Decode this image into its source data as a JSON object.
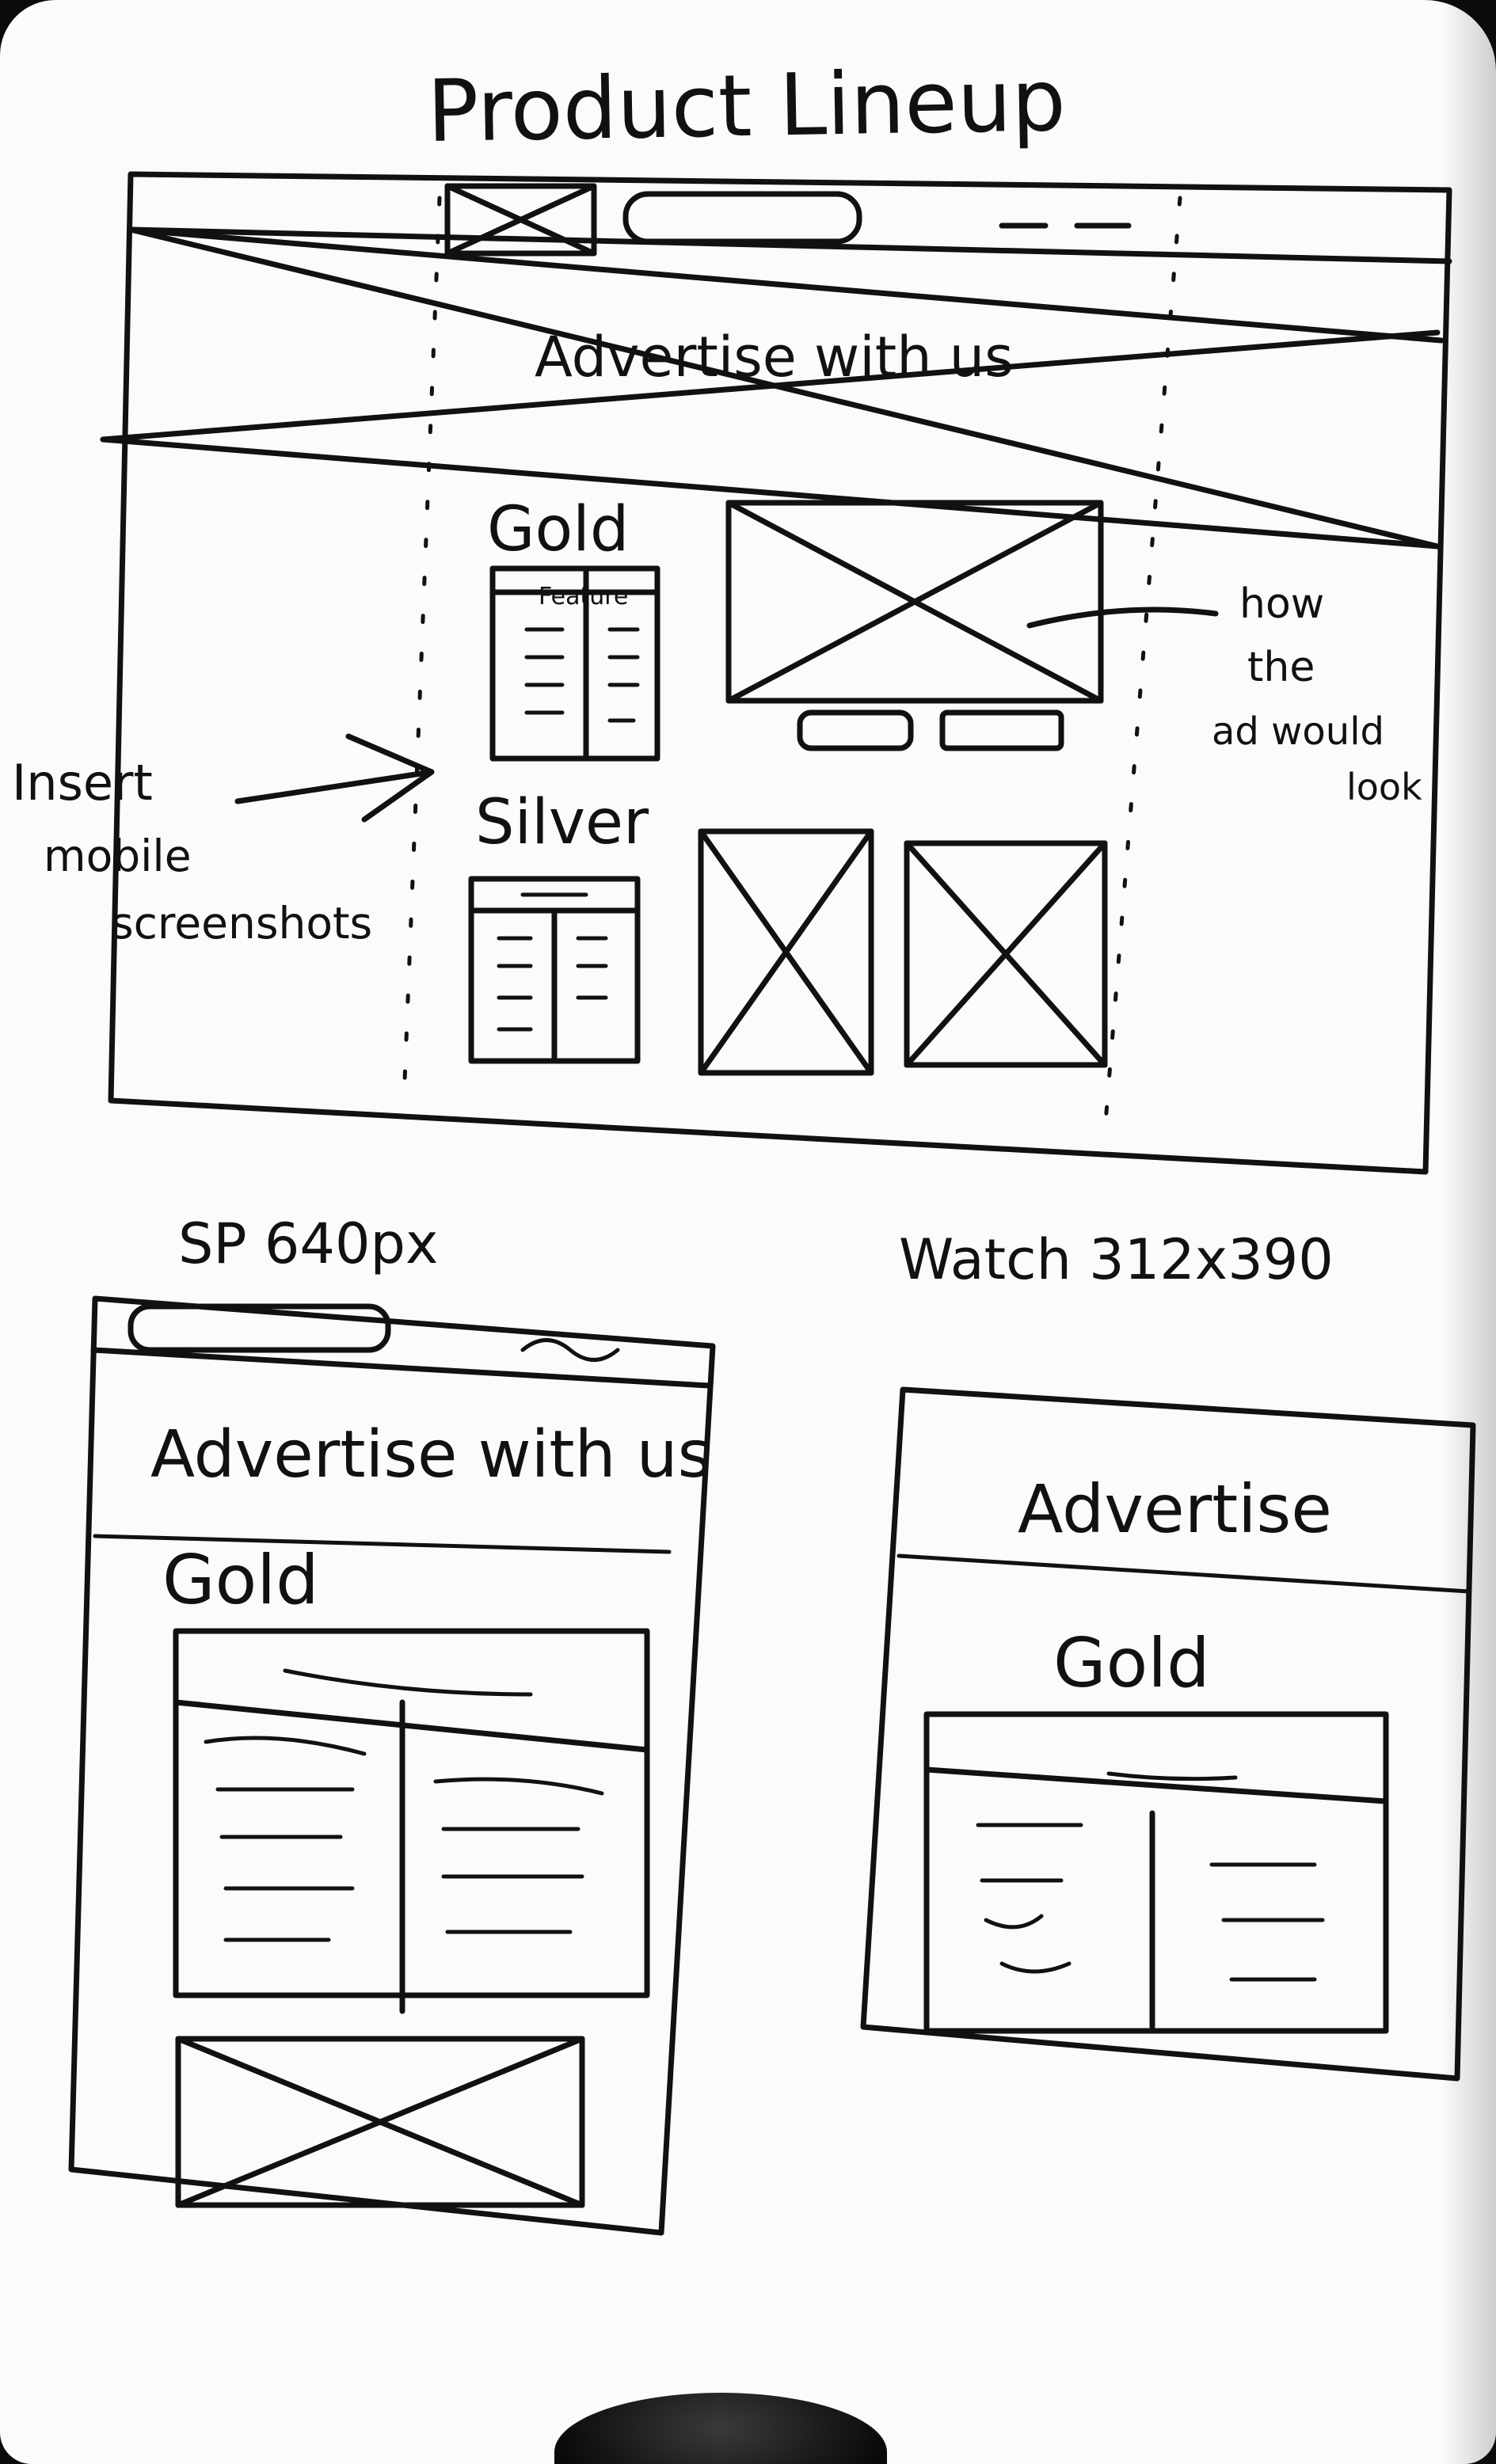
{
  "title": "Product Lineup",
  "desktop": {
    "banner_text": "Advertise with us",
    "tiers": {
      "gold": {
        "label": "Gold",
        "table_header": "Feature"
      },
      "silver": {
        "label": "Silver"
      }
    }
  },
  "notes": {
    "insert": [
      "Insert",
      "mobile",
      "screenshots"
    ],
    "how": [
      "how",
      "the",
      "ad would",
      "look"
    ]
  },
  "phone": {
    "label": "SP 640px",
    "heading": "Advertise with us",
    "tier": "Gold"
  },
  "watch": {
    "label": "Watch 312x390",
    "heading": "Advertise",
    "tier": "Gold"
  }
}
